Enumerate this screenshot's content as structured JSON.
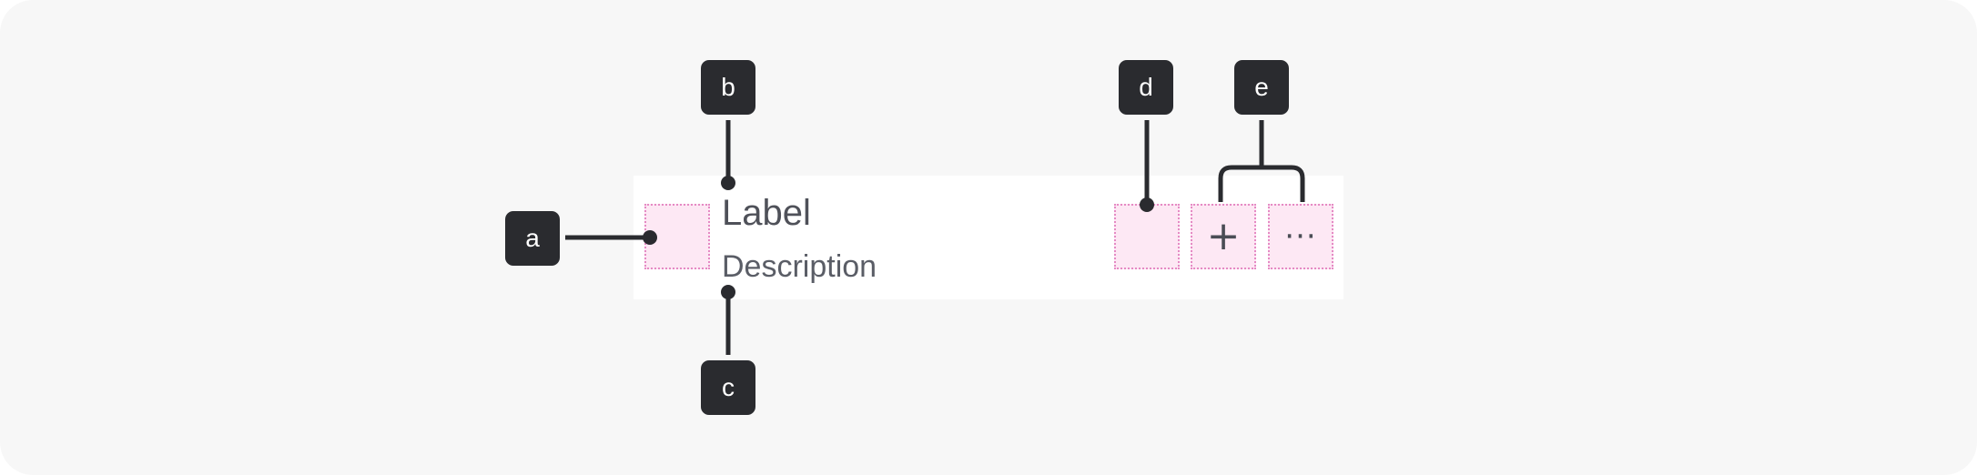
{
  "row": {
    "label": "Label",
    "description": "Description",
    "trailing_add_glyph": "+",
    "trailing_more_glyph": "···"
  },
  "callouts": {
    "a": "a",
    "b": "b",
    "c": "c",
    "d": "d",
    "e": "e"
  },
  "icons": {
    "add": "plus-icon",
    "more": "more-horizontal-icon"
  },
  "colors": {
    "background": "#f7f7f7",
    "row_background": "#ffffff",
    "slot_fill": "#fde8f4",
    "slot_border": "#e58ac4",
    "callout": "#2a2b2f",
    "text": "#4f5159"
  }
}
